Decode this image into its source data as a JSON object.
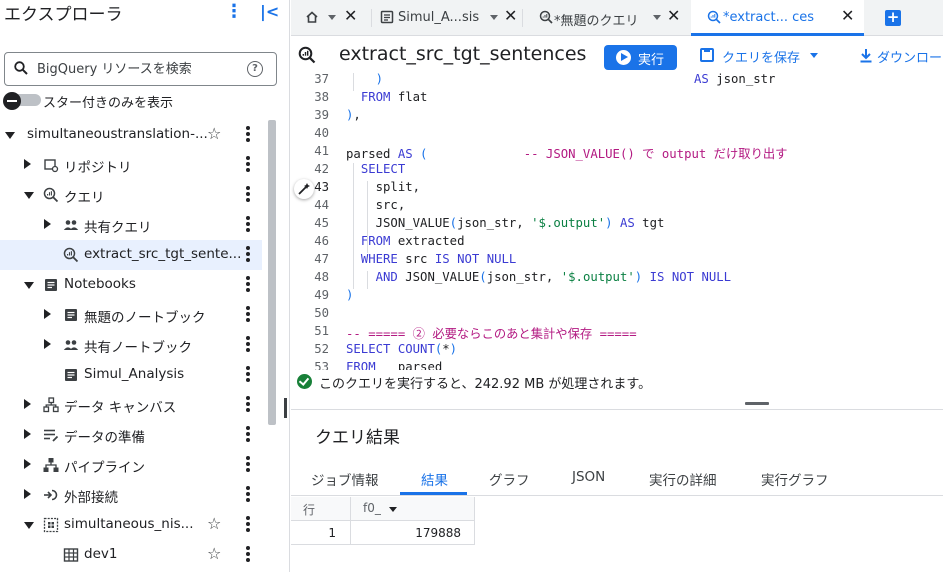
{
  "explorer": {
    "title": "エクスプローラ",
    "search_placeholder": "BigQuery リソースを検索",
    "starred_toggle_label": "スター付きのみを表示",
    "tree": [
      {
        "label": "simultaneoustranslation-...",
        "icon": "none",
        "expand": "down",
        "level": 0,
        "star": true,
        "more": true
      },
      {
        "label": "リポジトリ",
        "icon": "repository-icon",
        "expand": "right",
        "level": 1,
        "star": false,
        "more": true
      },
      {
        "label": "クエリ",
        "icon": "query-icon",
        "expand": "down",
        "level": 1,
        "star": false,
        "more": true
      },
      {
        "label": "共有クエリ",
        "icon": "people-icon",
        "expand": "right",
        "level": 2,
        "star": false,
        "more": true
      },
      {
        "label": "extract_src_tgt_sente...",
        "icon": "query-icon",
        "expand": "none",
        "level": 2,
        "star": false,
        "more": true,
        "selected": true
      },
      {
        "label": "Notebooks",
        "icon": "notebook-icon",
        "expand": "down",
        "level": 1,
        "star": false,
        "more": true
      },
      {
        "label": "無題のノートブック",
        "icon": "notebook-icon",
        "expand": "right",
        "level": 2,
        "star": false,
        "more": true
      },
      {
        "label": "共有ノートブック",
        "icon": "people-icon",
        "expand": "right",
        "level": 2,
        "star": false,
        "more": true
      },
      {
        "label": "Simul_Analysis",
        "icon": "notebook-icon",
        "expand": "none",
        "level": 2,
        "star": false,
        "more": true
      },
      {
        "label": "データ キャンバス",
        "icon": "canvas-icon",
        "expand": "right",
        "level": 1,
        "star": false,
        "more": true
      },
      {
        "label": "データの準備",
        "icon": "data-prep-icon",
        "expand": "right",
        "level": 1,
        "star": false,
        "more": true
      },
      {
        "label": "パイプライン",
        "icon": "pipeline-icon",
        "expand": "right",
        "level": 1,
        "star": false,
        "more": true
      },
      {
        "label": "外部接続",
        "icon": "connection-icon",
        "expand": "right",
        "level": 1,
        "star": false,
        "more": true
      },
      {
        "label": "simultaneous_nis...",
        "icon": "dataset-icon",
        "expand": "down",
        "level": 1,
        "star": true,
        "more": true
      },
      {
        "label": "dev1",
        "icon": "table-icon",
        "expand": "none",
        "level": 2,
        "star": true,
        "more": true
      }
    ]
  },
  "tabs": [
    {
      "label": "",
      "icon": "home-icon",
      "dropdown": true,
      "close": true
    },
    {
      "label": "Simul_A...sis",
      "icon": "notebook-icon",
      "dropdown": true,
      "close": true
    },
    {
      "label": "*無題のクエリ",
      "icon": "query-icon",
      "dropdown": true,
      "close": true
    },
    {
      "label": "*extract... ces",
      "icon": "query-icon",
      "dropdown": true,
      "close": true,
      "active": true
    }
  ],
  "query": {
    "title": "extract_src_tgt_sentences",
    "run_label": "実行",
    "save_label": "クエリを保存",
    "download_label": "ダウンロー"
  },
  "editor": {
    "current_line": 43,
    "lines": [
      {
        "n": 37,
        "code": "    )                                          AS json_str"
      },
      {
        "n": 38,
        "code": "  FROM flat"
      },
      {
        "n": 39,
        "code": "),"
      },
      {
        "n": 40,
        "code": ""
      },
      {
        "n": 41,
        "code": "parsed AS (             -- JSON_VALUE() で output だけ取り出す"
      },
      {
        "n": 42,
        "code": "  SELECT"
      },
      {
        "n": 43,
        "code": "    split,"
      },
      {
        "n": 44,
        "code": "    src,"
      },
      {
        "n": 45,
        "code": "    JSON_VALUE(json_str, '$.output') AS tgt"
      },
      {
        "n": 46,
        "code": "  FROM extracted"
      },
      {
        "n": 47,
        "code": "  WHERE src IS NOT NULL"
      },
      {
        "n": 48,
        "code": "    AND JSON_VALUE(json_str, '$.output') IS NOT NULL"
      },
      {
        "n": 49,
        "code": ")"
      },
      {
        "n": 50,
        "code": ""
      },
      {
        "n": 51,
        "code": "-- ===== ② 必要ならこのあと集計や保存 ====="
      },
      {
        "n": 52,
        "code": "SELECT COUNT(*)"
      },
      {
        "n": 53,
        "code": "FROM   parsed"
      }
    ]
  },
  "status": {
    "message": "このクエリを実行すると、242.92 MB が処理されます。"
  },
  "results": {
    "title": "クエリ結果",
    "tabs": [
      "ジョブ情報",
      "結果",
      "グラフ",
      "JSON",
      "実行の詳細",
      "実行グラフ"
    ],
    "active_tab": "結果",
    "columns": [
      "行",
      "f0_"
    ],
    "rows": [
      [
        "1",
        "179888"
      ]
    ]
  },
  "colors": {
    "accent": "#1a73e8",
    "success": "#188038",
    "selected_row": "#e8f0fe"
  }
}
